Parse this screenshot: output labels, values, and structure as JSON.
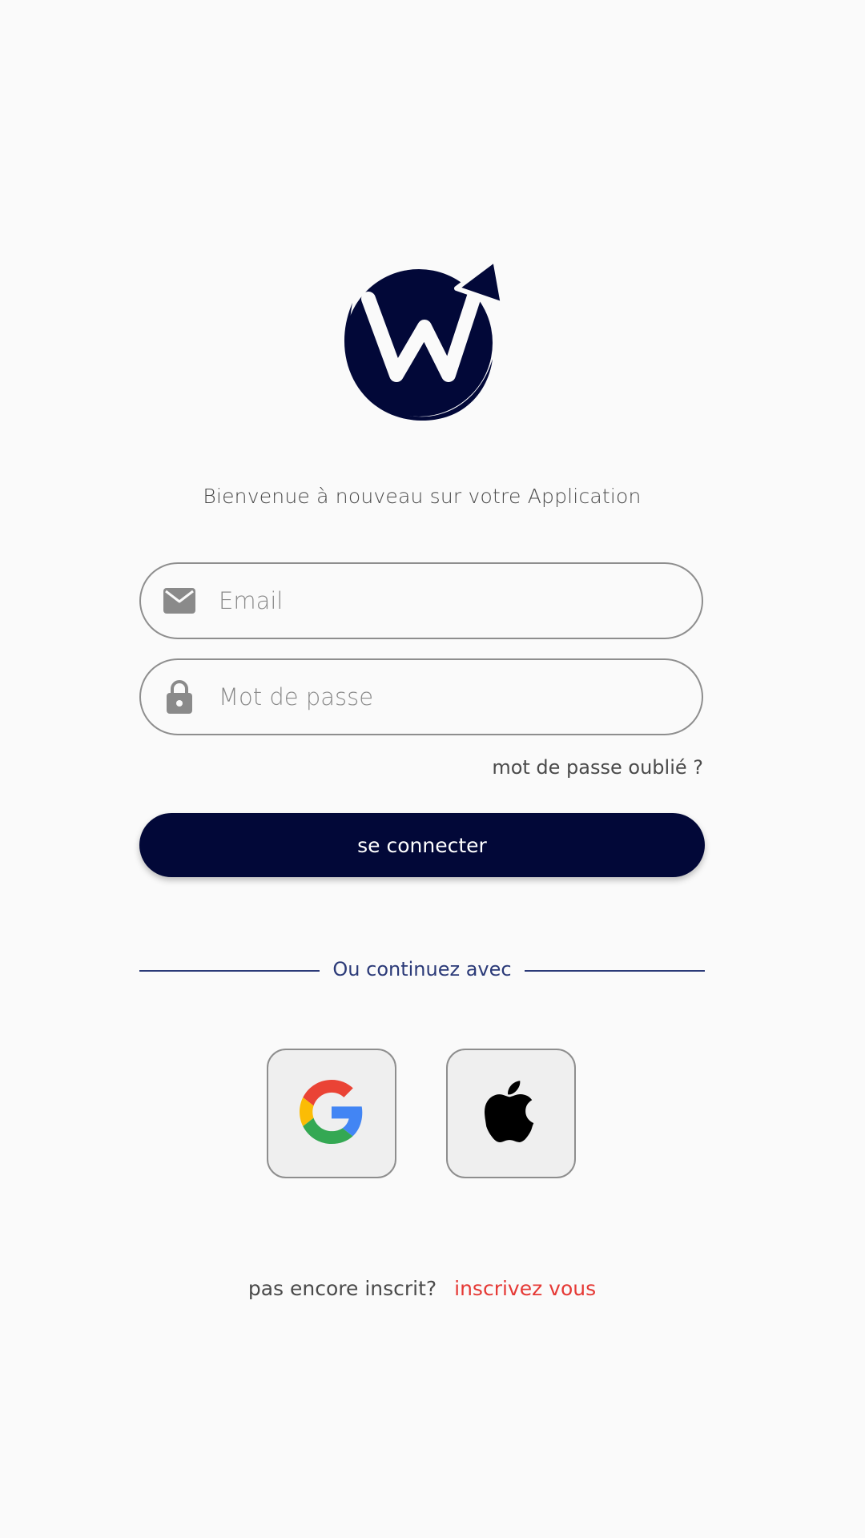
{
  "welcome_text": "Bienvenue à nouveau sur votre Application",
  "email_field": {
    "placeholder": "Email",
    "value": "",
    "icon": "envelope-icon"
  },
  "password_field": {
    "placeholder": "Mot de passe",
    "value": "",
    "icon": "lock-icon"
  },
  "forgot_password_label": "mot de passe oublié ?",
  "login_button_label": "se connecter",
  "divider_text": "Ou continuez avec",
  "social": {
    "google_icon": "google-icon",
    "apple_icon": "apple-icon"
  },
  "signup": {
    "prompt": "pas encore inscrit?",
    "link_label": "inscrivez vous"
  },
  "colors": {
    "primary": "#020838",
    "link_red": "#e53935",
    "divider": "#2b3a78",
    "background": "#fafafa"
  }
}
